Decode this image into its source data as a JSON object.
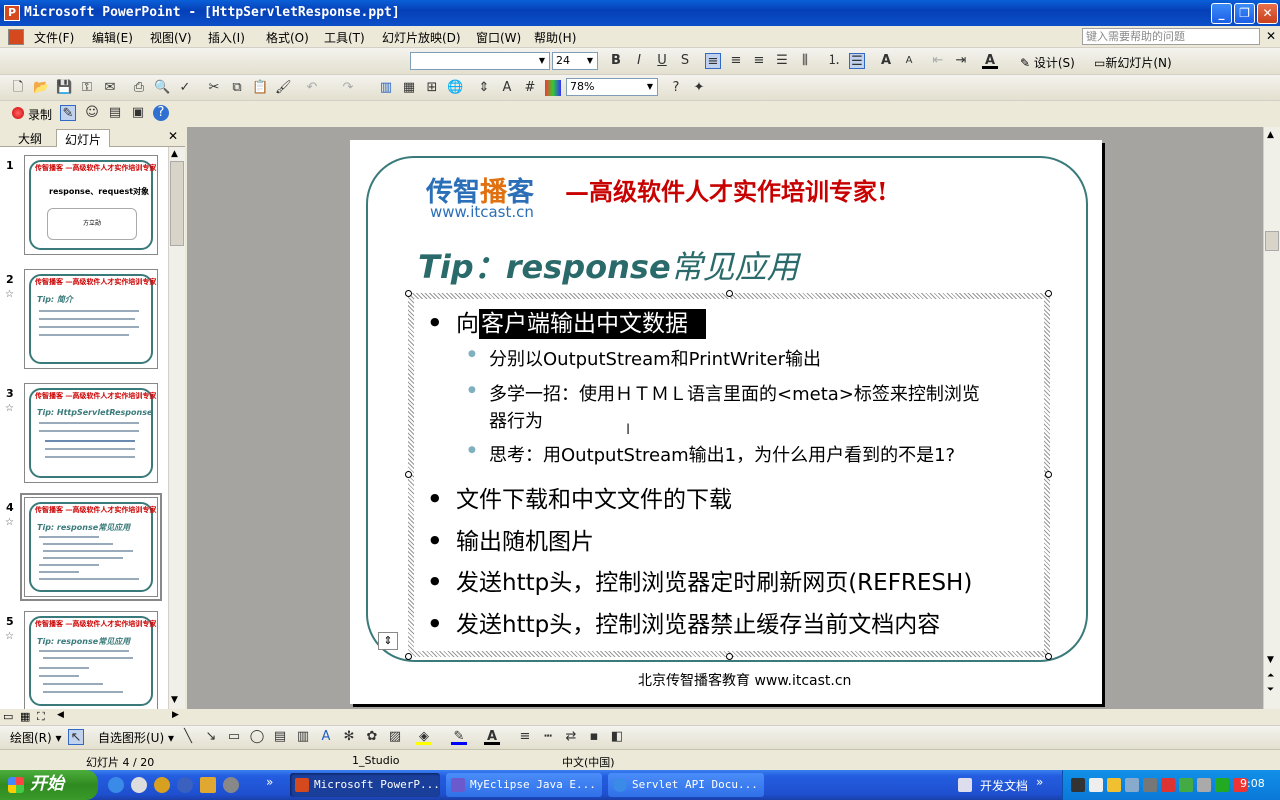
{
  "window": {
    "title": "Microsoft PowerPoint - [HttpServletResponse.ppt]",
    "app_icon_letter": "P"
  },
  "menu": {
    "items": [
      "文件(F)",
      "编辑(E)",
      "视图(V)",
      "插入(I)",
      "格式(O)",
      "工具(T)",
      "幻灯片放映(D)",
      "窗口(W)",
      "帮助(H)"
    ],
    "help_placeholder": "键入需要帮助的问题"
  },
  "formatting": {
    "font_size": "24",
    "design_label": "设计(S)",
    "new_slide_label": "新幻灯片(N)"
  },
  "standard": {
    "zoom": "78%"
  },
  "record": {
    "label": "录制"
  },
  "outline_tabs": {
    "outline": "大纲",
    "slides": "幻灯片"
  },
  "thumbnails": [
    {
      "num": "1",
      "title": "response、request对象"
    },
    {
      "num": "2",
      "title": "Tip: 简介"
    },
    {
      "num": "3",
      "title": "Tip: HttpServletResponse"
    },
    {
      "num": "4",
      "title": "Tip: response常见应用"
    },
    {
      "num": "5",
      "title": "Tip: response常见应用"
    }
  ],
  "slide": {
    "logo_main": "传智播客",
    "logo_url": "www.itcast.cn",
    "slogan": "—高级软件人才实作培训专家!",
    "title_en": "Tip：response",
    "title_cn": "常见应用",
    "bullet1_pre": "向",
    "bullet1_highlight": "客户端输出中文数据",
    "sub1": "分别以OutputStream和PrintWriter输出",
    "sub2_line1": "多学一招：使用ＨＴＭＬ语言里面的<meta>标签来控制浏览",
    "sub2_line2": "器行为",
    "sub3": "思考：用OutputStream输出1，为什么用户看到的不是1?",
    "bullet2": "文件下载和中文文件的下载",
    "bullet3": "输出随机图片",
    "bullet4": "发送http头，控制浏览器定时刷新网页(REFRESH)",
    "bullet5": "发送http头，控制浏览器禁止缓存当前文档内容",
    "footer": "北京传智播客教育 www.itcast.cn"
  },
  "drawing": {
    "draw_label": "绘图(R)",
    "autoshape_label": "自选图形(U)"
  },
  "status": {
    "slide_pos": "幻灯片 4 / 20",
    "design": "1_Studio",
    "language": "中文(中国)"
  },
  "taskbar": {
    "start_label": "开始",
    "tasks": [
      "Microsoft PowerP...",
      "MyEclipse Java E...",
      "Servlet API Docu..."
    ],
    "tray_label": "开发文档",
    "clock": "9:08"
  }
}
